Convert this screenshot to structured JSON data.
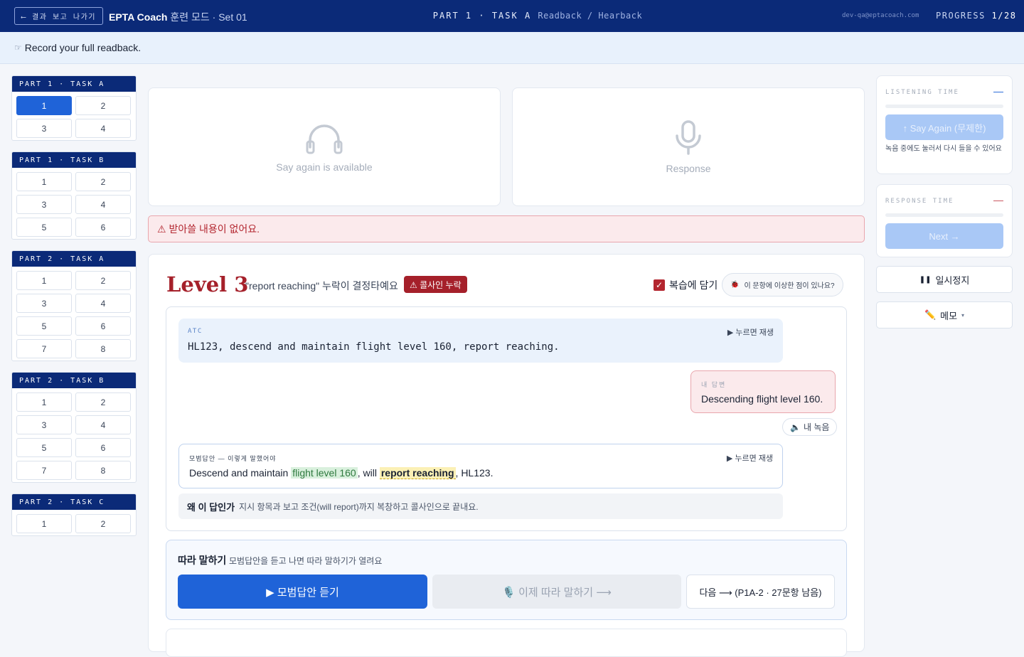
{
  "topbar": {
    "exit_label": "⟵ 결과 보고 나가기",
    "brand": "EPTA Coach",
    "mode": " 훈련 모드 · Set 01",
    "crumb_main": "PART 1 · TASK A",
    "crumb_sub": "Readback / Hearback",
    "email": "dev-qa@eptacoach.com",
    "progress_label": "PROGRESS",
    "progress_value": "1/28"
  },
  "instruction": {
    "text": "Record your full readback."
  },
  "sidenav": {
    "groups": [
      {
        "title": "PART 1 · TASK A",
        "items": [
          "1",
          "2",
          "3",
          "4"
        ]
      },
      {
        "title": "PART 1 · TASK B",
        "items": [
          "1",
          "2",
          "3",
          "4",
          "5",
          "6"
        ]
      },
      {
        "title": "PART 2 · TASK A",
        "items": [
          "1",
          "2",
          "3",
          "4",
          "5",
          "6",
          "7",
          "8"
        ]
      },
      {
        "title": "PART 2 · TASK B",
        "items": [
          "1",
          "2",
          "3",
          "4",
          "5",
          "6",
          "7",
          "8"
        ]
      },
      {
        "title": "PART 2 · TASK C",
        "items": [
          "1",
          "2"
        ]
      }
    ],
    "active_group": 0,
    "active_item": 0
  },
  "listen_card": {
    "label": "Say again is available",
    "icon": "headphones-icon"
  },
  "response_card": {
    "label": "Response",
    "icon": "microphone-icon"
  },
  "alert": {
    "text": "⚠ 받아쓸 내용이 없어요."
  },
  "feedback": {
    "level": "Level 3",
    "description": "\"report reaching\" 누락이 결정타예요",
    "badge": "⚠ 콜사인 누락",
    "review_label": "복습에 담기",
    "review_checked": true,
    "report_label": "이 문항에 이상한 점이 있나요?",
    "atc_tag": "ATC",
    "atc_play": "▶ 누르면 재생",
    "atc_text": "HL123, descend and maintain flight level 160, report reaching.",
    "mine_tag": "내 답변",
    "mine_text": "Descending flight level 160.",
    "my_recording": "내 녹음",
    "model_tag": "모범답안 — 이렇게 말했어야",
    "model_play": "▶ 누르면 재생",
    "model_parts": [
      "Descend and maintain ",
      "flight level 160",
      ", will ",
      "report reaching",
      ", HL123."
    ],
    "why_title": "왜 이 답인가",
    "why_text": "지시 항목과 보고 조건(will report)까지 복창하고 콜사인으로 끝내요."
  },
  "shadowing": {
    "title": "따라 말하기",
    "subtitle": "모범답안을 듣고 나면 따라 말하기가 열려요",
    "listen_btn": "▶ 모범답안 듣기",
    "repeat_btn": "🎙️ 이제 따라 말하기 ⟶",
    "next_btn": "다음 ⟶ (P1A-2 · 27문항 남음)"
  },
  "right_panel": {
    "listening_title": "LISTENING TIME",
    "listening_dash": "—",
    "say_again": "↑ Say Again (무제한)",
    "say_again_note": "녹음 중에도 눌러서 다시 들을 수 있어요",
    "response_title": "RESPONSE TIME",
    "response_dash": "—",
    "next": "Next →",
    "pause": "일시정지",
    "memo": "메모",
    "memo_caret": "▾"
  },
  "colors": {
    "navy": "#0b2a78",
    "accent": "#1f63d8",
    "danger": "#a5202a"
  }
}
